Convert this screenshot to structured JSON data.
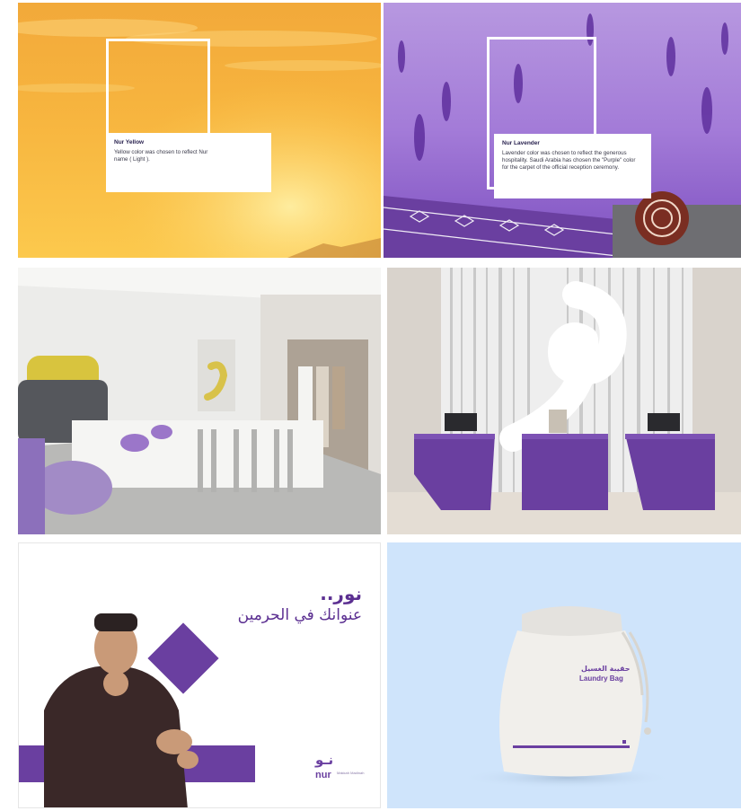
{
  "swatches": {
    "yellow": {
      "title": "Nur Yellow",
      "description": "Yellow color was chosen to reflect Nur name ( Light )."
    },
    "lavender": {
      "title": "Nur Lavender",
      "description": "Lavender color was chosen to reflect the generous hospitality.  Saudi Arabia has chosen the \"Purple\" color for the carpet of the official reception ceremony."
    }
  },
  "poster": {
    "headline": "نور..",
    "subline": "عنوانك في الحرمين",
    "brand_arabic": "نـو",
    "brand_latin": "nur",
    "brand_tagline": "Makkah Madinah"
  },
  "bag": {
    "label_arabic": "حقيبة الغسيل",
    "label_english": "Laundry Bag"
  },
  "colors": {
    "nur_purple": "#6a3fa0",
    "nur_yellow": "#f5b23a",
    "lavender": "#8e5ad0",
    "bag_background": "#cfe4fb"
  },
  "icons": [
    "waw-letter-mark",
    "diamond-shape",
    "nur-logo"
  ]
}
